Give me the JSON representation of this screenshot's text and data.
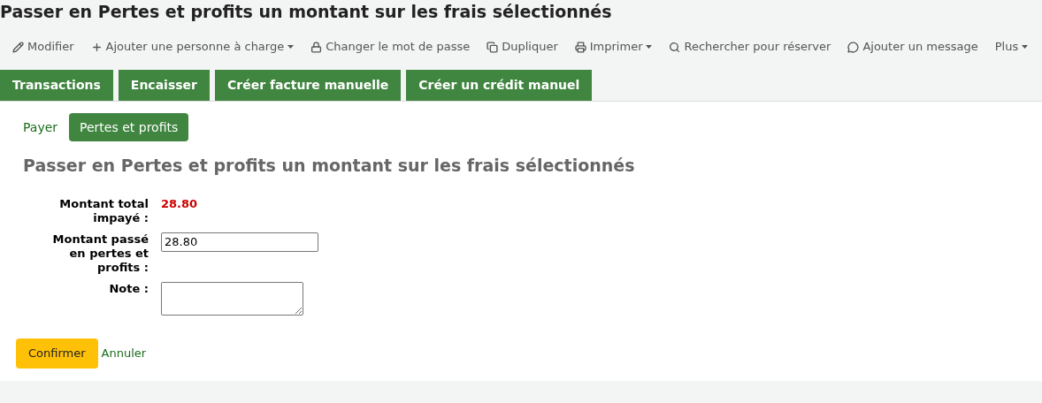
{
  "page_title": "Passer en Pertes et profits un montant sur les frais sélectionnés",
  "toolbar": [
    {
      "label": "Modifier",
      "dropdown": false
    },
    {
      "label": "Ajouter une personne à charge",
      "dropdown": true
    },
    {
      "label": "Changer le mot de passe",
      "dropdown": false
    },
    {
      "label": "Dupliquer",
      "dropdown": false
    },
    {
      "label": "Imprimer",
      "dropdown": true
    },
    {
      "label": "Rechercher pour réserver",
      "dropdown": false
    },
    {
      "label": "Ajouter un message",
      "dropdown": false
    },
    {
      "label": "Plus",
      "dropdown": true
    }
  ],
  "tabs": [
    "Transactions",
    "Encaisser",
    "Créer facture manuelle",
    "Créer un crédit manuel"
  ],
  "subtabs": [
    {
      "label": "Payer",
      "selected": false
    },
    {
      "label": "Pertes et profits",
      "selected": true
    }
  ],
  "form": {
    "heading": "Passer en Pertes et profits un montant sur les frais sélectionnés",
    "total_label": "Montant total impayé :",
    "total_value": "28.80",
    "writeoff_label": "Montant passé en pertes et profits :",
    "writeoff_value": "28.80",
    "note_label": "Note :"
  },
  "buttons": {
    "confirm": "Confirmer",
    "cancel": "Annuler"
  }
}
